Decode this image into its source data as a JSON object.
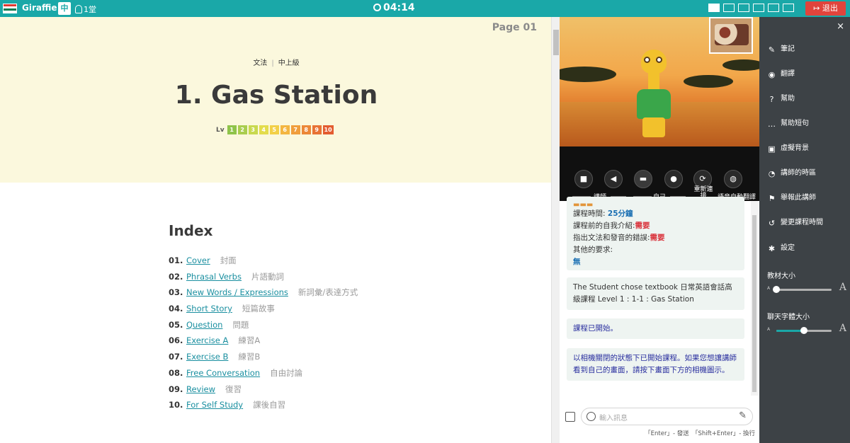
{
  "topbar": {
    "brand": "Giraffie",
    "translate_icon": "中",
    "seat_count": "1堂",
    "clock": "04:14",
    "exit_label": "退出",
    "layout_icons": [
      "layout-1",
      "layout-2",
      "layout-3",
      "layout-4",
      "layout-5",
      "layout-6"
    ]
  },
  "textbook": {
    "page": "Page 01",
    "category": "文法",
    "level_name": "中上級",
    "title": "1. Gas Station",
    "level_prefix": "Lv",
    "levels": [
      {
        "n": "1",
        "color": "#8fc44a"
      },
      {
        "n": "2",
        "color": "#a9cd4e"
      },
      {
        "n": "3",
        "color": "#c8d94e"
      },
      {
        "n": "4",
        "color": "#e3dc4c"
      },
      {
        "n": "5",
        "color": "#f2d047"
      },
      {
        "n": "6",
        "color": "#f3b641"
      },
      {
        "n": "7",
        "color": "#f09e3c"
      },
      {
        "n": "8",
        "color": "#ec8838"
      },
      {
        "n": "9",
        "color": "#e87335"
      },
      {
        "n": "10",
        "color": "#e35c30"
      }
    ],
    "index_heading": "Index",
    "index": [
      {
        "num": "01.",
        "en": "Cover",
        "zh": "封面"
      },
      {
        "num": "02.",
        "en": "Phrasal Verbs",
        "zh": "片語動詞"
      },
      {
        "num": "03.",
        "en": "New Words / Expressions",
        "zh": "新詞彙/表達方式"
      },
      {
        "num": "04.",
        "en": "Short Story",
        "zh": "短篇故事"
      },
      {
        "num": "05.",
        "en": "Question",
        "zh": "問題"
      },
      {
        "num": "06.",
        "en": "Exercise A",
        "zh": "練習A"
      },
      {
        "num": "07.",
        "en": "Exercise B",
        "zh": "練習B"
      },
      {
        "num": "08.",
        "en": "Free Conversation",
        "zh": "自由討論"
      },
      {
        "num": "09.",
        "en": "Review",
        "zh": "復習"
      },
      {
        "num": "10.",
        "en": "For Self Study",
        "zh": "課後自習"
      }
    ]
  },
  "video": {
    "controls": [
      {
        "icon": "camera-icon",
        "glyph": "■"
      },
      {
        "icon": "speaker-icon",
        "glyph": "◀"
      },
      {
        "icon": "camera-off-icon",
        "glyph": "▬"
      },
      {
        "icon": "microphone-icon",
        "glyph": "●"
      },
      {
        "icon": "reconnect-icon",
        "glyph": "⟳"
      },
      {
        "icon": "globe-icon",
        "glyph": "◍"
      }
    ],
    "label_teacher": "講師",
    "label_self": "自己",
    "label_reconnect": "重新連接",
    "label_auto_translate": "語音自動翻譯"
  },
  "chat": {
    "m1_l1_label": "課程時間: ",
    "m1_l1_val": "25分鐘",
    "m1_l2_label": "課程前的自我介紹:",
    "m1_l2_val": "需要",
    "m1_l3_label": "指出文法和發音的錯誤:",
    "m1_l3_val": "需要",
    "m1_l4_label": "其他的要求:",
    "m1_l4_val": "無",
    "m2": "The Student chose textbook 日常英語會話高級課程 Level 1 : 1-1 : Gas Station",
    "m3": "課程已開始。",
    "m4": "以相機關閉的狀態下已開始課程。如果您想讓講師看到自己的畫面，請按下畫面下方的相機圖示。",
    "input_placeholder": "輸入訊息",
    "hint": "「Enter」- 發送　「Shift+Enter」- 換行"
  },
  "menu": {
    "close": "×",
    "items": [
      {
        "icon": "note-icon",
        "glyph": "✎",
        "label": "筆記"
      },
      {
        "icon": "translate-icon",
        "glyph": "◉",
        "label": "翻譯"
      },
      {
        "icon": "help-icon",
        "glyph": "?",
        "label": "幫助"
      },
      {
        "icon": "chat-bubble-icon",
        "glyph": "…",
        "label": "幫助短句"
      },
      {
        "icon": "image-icon",
        "glyph": "▣",
        "label": "虛擬背景"
      },
      {
        "icon": "clock-globe-icon",
        "glyph": "◔",
        "label": "講師的時區"
      },
      {
        "icon": "flag-icon",
        "glyph": "⚑",
        "label": "舉報此講師"
      },
      {
        "icon": "reschedule-icon",
        "glyph": "↺",
        "label": "變更課程時間"
      },
      {
        "icon": "settings-icon",
        "glyph": "✱",
        "label": "設定"
      }
    ],
    "textbook_size_label": "教材大小",
    "textbook_size_level": 0.0,
    "chat_font_label": "聊天字體大小",
    "chat_font_level": 0.5,
    "small_a": "A",
    "large_a": "A"
  }
}
